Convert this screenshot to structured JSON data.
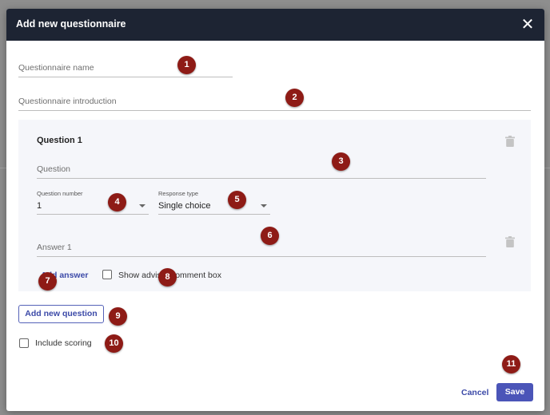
{
  "dialog": {
    "title": "Add new questionnaire",
    "close_icon": "close-icon"
  },
  "form": {
    "name_placeholder": "Questionnaire name",
    "intro_placeholder": "Questionnaire introduction"
  },
  "question": {
    "title": "Question 1",
    "question_placeholder": "Question",
    "number_label": "Question number",
    "number_value": "1",
    "response_label": "Response type",
    "response_value": "Single choice",
    "answer_placeholder": "Answer 1",
    "add_answer": "Add answer",
    "comment_box_label": "Show adviser comment box"
  },
  "actions": {
    "add_question": "Add new question",
    "scoring_label": "Include scoring",
    "cancel": "Cancel",
    "save": "Save"
  },
  "annotations": [
    "1",
    "2",
    "3",
    "4",
    "5",
    "6",
    "7",
    "8",
    "9",
    "10",
    "11"
  ],
  "colors": {
    "header_bg": "#1d2433",
    "accent": "#4b55b8",
    "badge": "#8e1b16",
    "card_bg": "#f5f6fa"
  }
}
